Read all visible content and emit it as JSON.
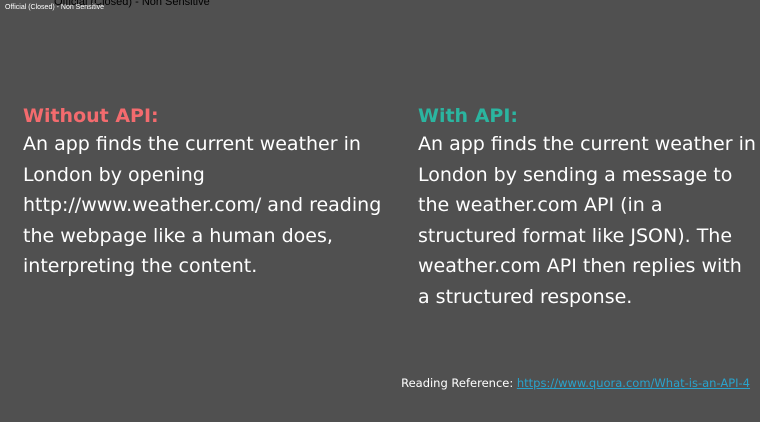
{
  "classification": {
    "top_label": "Official (Closed) - Non Sensitive",
    "corner_label": "Official (Closed) - Non Sensitive"
  },
  "without_api": {
    "heading": "Without API:",
    "body": "An app finds the current weather in London by opening http://www.weather.com/ and reading the webpage like a human does, interpreting the content."
  },
  "with_api": {
    "heading": "With API:",
    "body": "An app finds the current weather in London by sending a message to the weather.com API (in a structured format like JSON). The weather.com API then replies with a structured response."
  },
  "reference": {
    "prefix": "Reading Reference: ",
    "link_text": "https://www.quora.com/What-is-an-API-4"
  },
  "colors": {
    "background": "#505050",
    "without_heading": "#f36b6e",
    "with_heading": "#2bb5a0",
    "link": "#29a3cc"
  }
}
